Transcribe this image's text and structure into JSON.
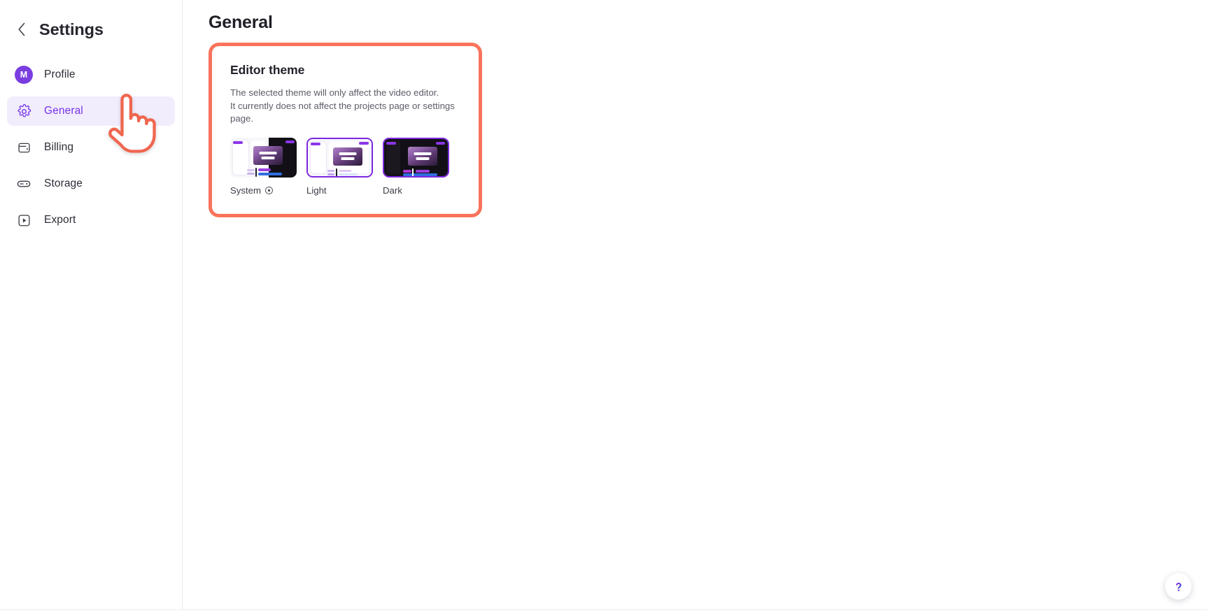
{
  "sidebar": {
    "back_icon": "chevron-left-icon",
    "title": "Settings",
    "items": [
      {
        "label": "Profile",
        "icon": "avatar-icon",
        "avatar_initial": "M",
        "active": false
      },
      {
        "label": "General",
        "icon": "gear-icon",
        "active": true
      },
      {
        "label": "Billing",
        "icon": "wallet-icon",
        "active": false
      },
      {
        "label": "Storage",
        "icon": "storage-icon",
        "active": false
      },
      {
        "label": "Export",
        "icon": "export-icon",
        "active": false
      }
    ]
  },
  "main": {
    "page_title": "General",
    "theme_card": {
      "title": "Editor theme",
      "description_line1": "The selected theme will only affect the video editor.",
      "description_line2": "It currently does not affect the projects page or settings page.",
      "info_icon": "info-circle-icon",
      "options": [
        {
          "label": "System",
          "selected": false,
          "has_info_icon": true
        },
        {
          "label": "Light",
          "selected": true,
          "has_info_icon": false
        },
        {
          "label": "Dark",
          "selected": true,
          "has_info_icon": false
        }
      ]
    }
  },
  "help_button": {
    "icon": "question-mark-icon"
  },
  "annotation": {
    "type": "highlight-rectangle",
    "color": "#f9735b"
  },
  "cursor": {
    "type": "pointing-hand-cursor",
    "color": "#f0664f"
  },
  "colors": {
    "accent_purple": "#7534e8",
    "active_nav_bg": "#f2edfd",
    "annotation_red": "#f9735b",
    "avatar_purple": "#7a3ee0",
    "text_primary": "#22222b",
    "text_secondary": "#5c5c68"
  }
}
